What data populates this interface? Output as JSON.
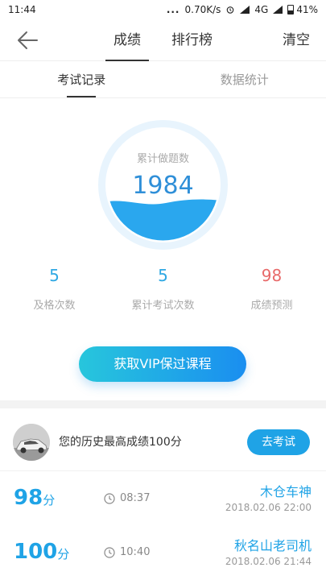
{
  "status_bar": {
    "time": "11:44",
    "dots": "...",
    "speed": "0.70K/s",
    "network": "4G",
    "battery": "41%"
  },
  "nav": {
    "back_icon": "back-arrow-icon",
    "tabs": [
      {
        "label": "成绩",
        "active": true
      },
      {
        "label": "排行榜",
        "active": false
      }
    ],
    "clear_label": "清空"
  },
  "subtabs": [
    {
      "label": "考试记录",
      "active": true
    },
    {
      "label": "数据统计",
      "active": false
    }
  ],
  "gauge": {
    "label": "累计做题数",
    "value": "1984"
  },
  "stats": [
    {
      "value": "5",
      "label": "及格次数",
      "color": "#2fa8e3"
    },
    {
      "value": "5",
      "label": "累计考试次数",
      "color": "#2fa8e3"
    },
    {
      "value": "98",
      "label": "成绩预测",
      "color": "#e86a6a"
    }
  ],
  "vip_button": "获取VIP保过课程",
  "best": {
    "text": "您的历史最高成绩100分",
    "button": "去考试"
  },
  "records": [
    {
      "score": "98",
      "unit": "分",
      "time": "08:37",
      "name": "木仓车神",
      "date": "2018.02.06  22:00"
    },
    {
      "score": "100",
      "unit": "分",
      "time": "10:40",
      "name": "秋名山老司机",
      "date": "2018.02.06  21:44"
    }
  ],
  "colors": {
    "accent": "#1fa3e6",
    "gauge_fill": "#2aa7ee",
    "gauge_ring": "#e8f4fd",
    "prediction": "#e86a6a"
  }
}
